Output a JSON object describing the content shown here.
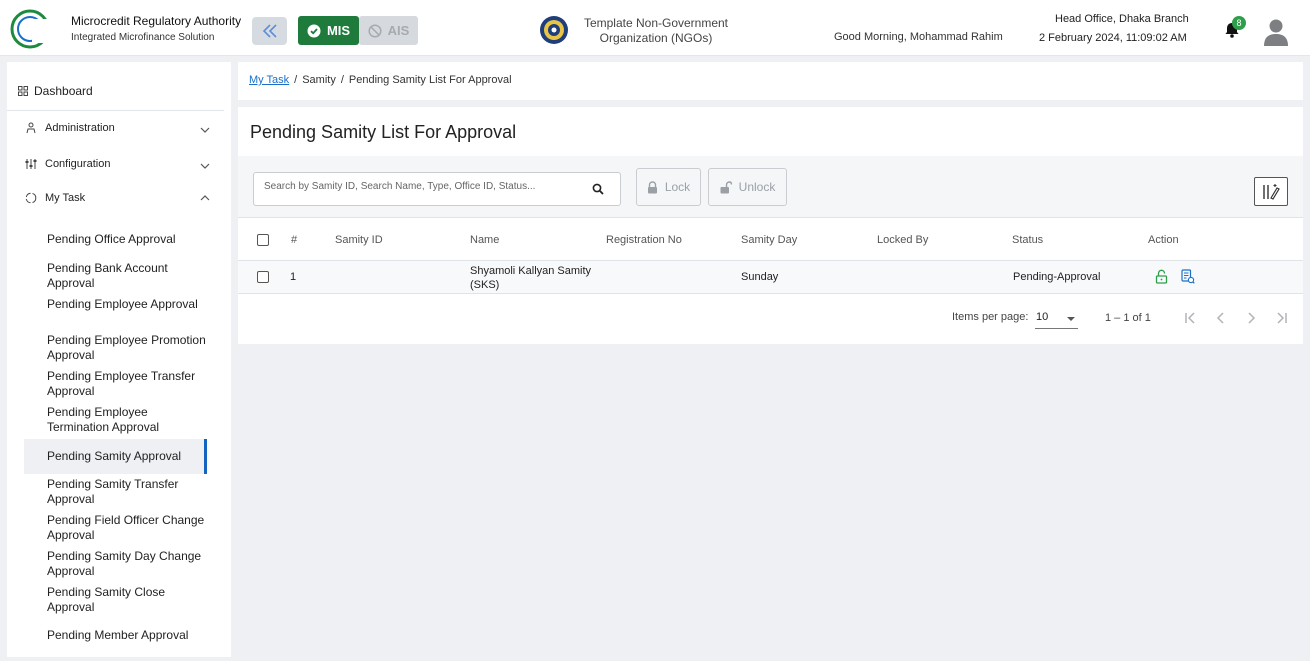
{
  "header": {
    "brand_title": "Microcredit Regulatory Authority",
    "brand_sub": "Integrated Microfinance Solution",
    "logo_text": "Microcredit Regulatory Authority",
    "mis_label": "MIS",
    "ais_label": "AIS",
    "org_line1": "Template Non-Government",
    "org_line2": "Organization (NGOs)",
    "greeting": "Good Morning, Mohammad Rahim",
    "branch": "Head Office, Dhaka Branch",
    "datetime": "2 February 2024, 11:09:02 AM",
    "notification_count": "8"
  },
  "sidebar": {
    "dashboard": "Dashboard",
    "groups": [
      {
        "label": "Administration",
        "icon": "admin-icon"
      },
      {
        "label": "Configuration",
        "icon": "config-icon"
      },
      {
        "label": "My Task",
        "icon": "task-icon"
      }
    ],
    "items": [
      "Pending Office Approval",
      "Pending Bank Account Approval",
      "Pending Employee Approval",
      "Pending Employee Promotion Approval",
      "Pending Employee Transfer Approval",
      "Pending Employee Termination Approval",
      "Pending Samity Approval",
      "Pending Samity Transfer Approval",
      "Pending Field Officer Change Approval",
      "Pending Samity Day Change Approval",
      "Pending Samity Close Approval",
      "Pending Member Approval"
    ]
  },
  "breadcrumb": {
    "items": [
      "My Task",
      "Samity",
      "Pending Samity List For Approval"
    ],
    "separator": "/"
  },
  "main": {
    "title": "Pending Samity List For Approval",
    "search_placeholder": "Search by Samity ID, Search Name, Type, Office ID, Status...",
    "lock_label": "Lock",
    "unlock_label": "Unlock"
  },
  "table": {
    "columns": [
      "#",
      "Samity ID",
      "Name",
      "Registration No",
      "Samity Day",
      "Locked By",
      "Status",
      "Action"
    ],
    "rows": [
      {
        "index": "1",
        "samity_id": "",
        "name_line1": "Shyamoli Kallyan Samity",
        "name_line2": "(SKS)",
        "registration_no": "",
        "samity_day": "Sunday",
        "locked_by": "",
        "status": "Pending-Approval"
      }
    ]
  },
  "paginator": {
    "items_per_page_label": "Items per page:",
    "page_size": "10",
    "range": "1 – 1 of 1"
  },
  "colors": {
    "accent": "#1565c0",
    "mis_green": "#1e7b3c",
    "badge_green": "#2e9e4a",
    "action_green": "#2e9e4a",
    "action_blue": "#1a6fc9"
  }
}
